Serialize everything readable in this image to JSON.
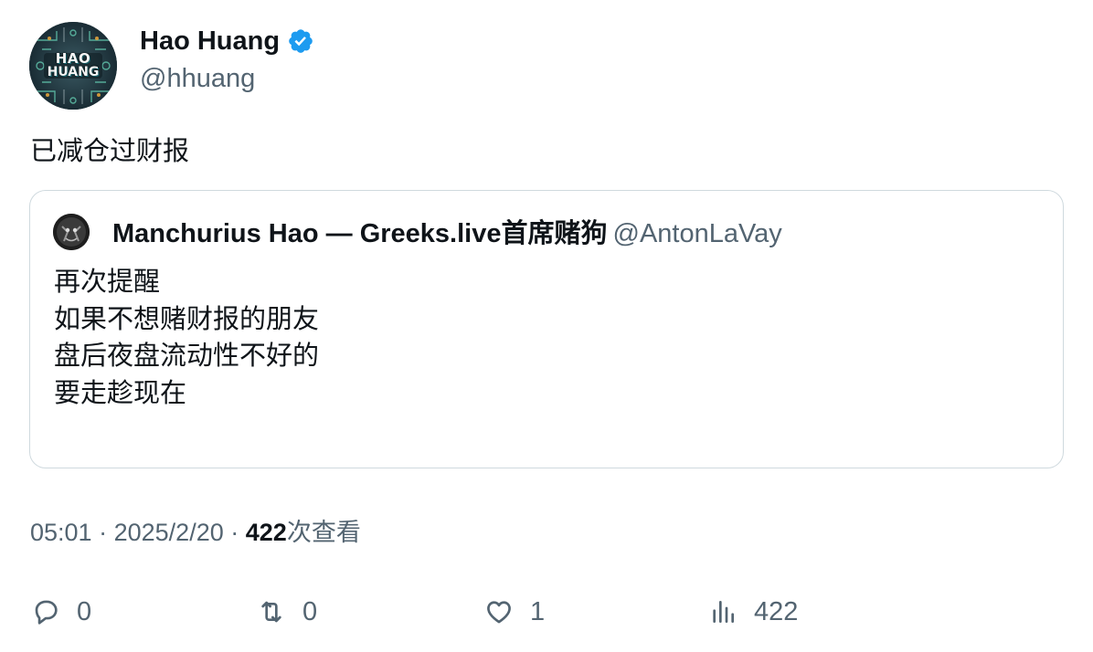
{
  "author": {
    "name": "Hao Huang",
    "handle": "@hhuang",
    "avatar_text": "HAO HUANG",
    "verified_color": "#1d9bf0"
  },
  "tweet": {
    "text": "已减仓过财报"
  },
  "quote": {
    "name": "Manchurius Hao — Greeks.live首席赌狗",
    "handle": "@AntonLaVay",
    "lines": [
      "再次提醒",
      "如果不想赌财报的朋友",
      "盘后夜盘流动性不好的",
      "要走趁现在"
    ]
  },
  "meta": {
    "time": "05:01",
    "separator": "·",
    "date": "2025/2/20",
    "views_count": "422",
    "views_label": "次查看"
  },
  "actions": {
    "reply": {
      "icon": "reply-icon",
      "count": "0"
    },
    "retweet": {
      "icon": "retweet-icon",
      "count": "0"
    },
    "like": {
      "icon": "heart-icon",
      "count": "1"
    },
    "views": {
      "icon": "analytics-icon",
      "count": "422"
    }
  }
}
